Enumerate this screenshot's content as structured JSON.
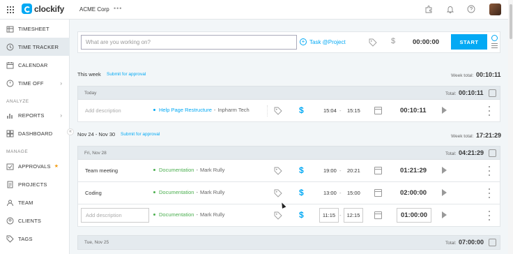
{
  "header": {
    "app_name": "clockify",
    "workspace": "ACME Corp",
    "workspace_more": "•••"
  },
  "sidebar": {
    "items": [
      {
        "label": "TIMESHEET",
        "icon": "timesheet-icon"
      },
      {
        "label": "TIME TRACKER",
        "icon": "clock-icon",
        "active": true
      },
      {
        "label": "CALENDAR",
        "icon": "calendar-icon"
      },
      {
        "label": "TIME OFF",
        "icon": "time-off-icon",
        "chevron": true
      },
      {
        "label": "REPORTS",
        "icon": "reports-icon",
        "chevron": true
      },
      {
        "label": "DASHBOARD",
        "icon": "dashboard-icon"
      },
      {
        "label": "APPROVALS",
        "icon": "approvals-icon",
        "star": true
      },
      {
        "label": "PROJECTS",
        "icon": "projects-icon"
      },
      {
        "label": "TEAM",
        "icon": "team-icon"
      },
      {
        "label": "CLIENTS",
        "icon": "clients-icon"
      },
      {
        "label": "TAGS",
        "icon": "tags-icon"
      }
    ],
    "sections": {
      "analyze": "ANALYZE",
      "manage": "MANAGE"
    }
  },
  "tracker": {
    "placeholder": "What are you working on?",
    "task_project": "Task @Project",
    "time": "00:00:00",
    "start_label": "START"
  },
  "weeks": [
    {
      "title": "This week",
      "submit": "Submit for approval",
      "total_label": "Week total:",
      "total": "00:10:11",
      "days": [
        {
          "title": "Today",
          "total_label": "Total:",
          "total": "00:10:11",
          "entries": [
            {
              "description": "Add description",
              "project": "Help Page Restructure",
              "project_color": "#03a9f4",
              "client": "Inpharm Tech",
              "start": "15:04",
              "end": "15:15",
              "duration": "00:10:11"
            }
          ]
        }
      ]
    },
    {
      "title": "Nov 24 - Nov 30",
      "submit": "Submit for approval",
      "total_label": "Week total:",
      "total": "17:21:29",
      "days": [
        {
          "title": "Fri, Nov 28",
          "total_label": "Total:",
          "total": "04:21:29",
          "entries": [
            {
              "description": "Team meeting",
              "project": "Documentation",
              "project_color": "#4caf50",
              "client": "Mark Rully",
              "start": "19:00",
              "end": "20:21",
              "duration": "01:21:29"
            },
            {
              "description": "Coding",
              "project": "Documentation",
              "project_color": "#4caf50",
              "client": "Mark Rully",
              "start": "13:00",
              "end": "15:00",
              "duration": "02:00:00"
            },
            {
              "description": "Add description",
              "project": "Documentation",
              "project_color": "#4caf50",
              "client": "Mark Rully",
              "start": "11:15",
              "end": "12:15",
              "duration": "01:00:00"
            }
          ]
        },
        {
          "title": "Tue, Nov 25",
          "total_label": "Total:",
          "total": "07:00:00"
        }
      ]
    }
  ],
  "dash": "-",
  "client_sep": "-"
}
